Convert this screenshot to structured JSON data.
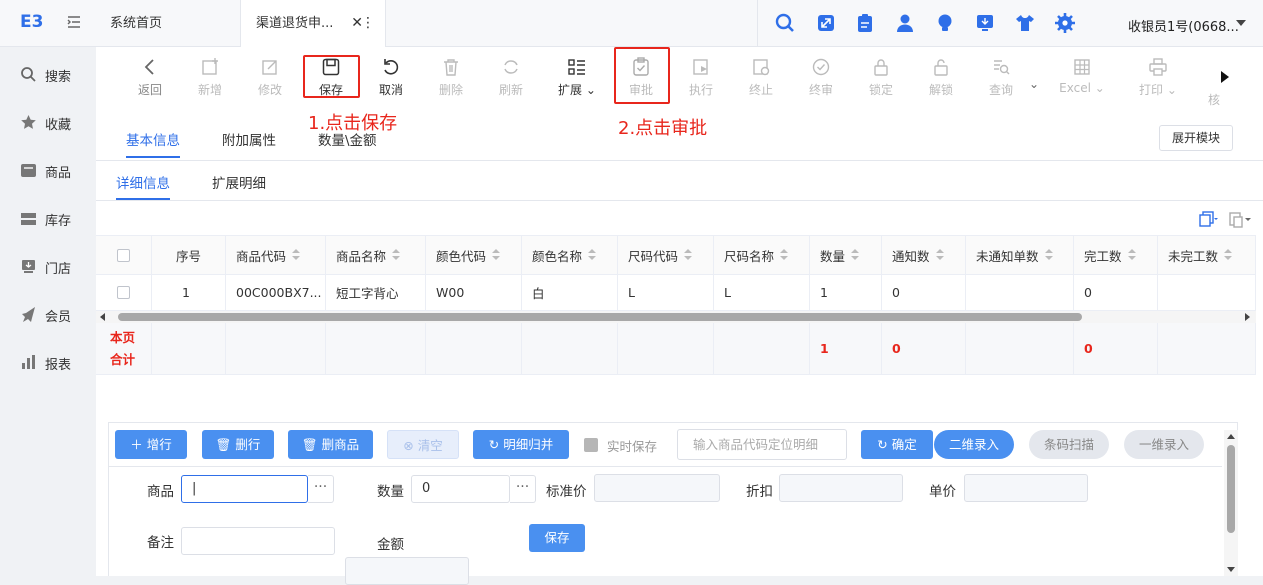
{
  "app": {
    "logo_text": "E3",
    "user": "收银员1号(0668...",
    "accent": "#2f6fe8",
    "annotation_color": "#e8261c"
  },
  "tabs": {
    "home": "系统首页",
    "active": "渠道退货申..."
  },
  "top_icons": [
    "search-icon",
    "expand-icon",
    "clipboard-icon",
    "user-icon",
    "bulb-icon",
    "monitor-icon",
    "shirt-icon",
    "gear-icon"
  ],
  "sidebar": {
    "items": [
      {
        "label": "搜索",
        "icon": "search-icon"
      },
      {
        "label": "收藏",
        "icon": "star-icon"
      },
      {
        "label": "商品",
        "icon": "product-icon"
      },
      {
        "label": "库存",
        "icon": "inventory-icon"
      },
      {
        "label": "门店",
        "icon": "store-icon"
      },
      {
        "label": "会员",
        "icon": "member-icon"
      },
      {
        "label": "报表",
        "icon": "report-icon"
      }
    ]
  },
  "toolbar": {
    "back": "返回",
    "add": "新增",
    "edit": "修改",
    "save": "保存",
    "cancel": "取消",
    "delete": "删除",
    "refresh": "刷新",
    "extend": "扩展",
    "approve": "审批",
    "execute": "执行",
    "stop": "终止",
    "final_review": "终审",
    "lock": "锁定",
    "unlock": "解锁",
    "query": "查询",
    "excel": "Excel",
    "print": "打印",
    "more": "核"
  },
  "annotations": {
    "step1": "1.点击保存",
    "step2": "2.点击审批"
  },
  "subtabs": {
    "basic": "基本信息",
    "attrs": "附加属性",
    "qty": "数量\\金额",
    "expand_module": "展开模块"
  },
  "detail_tabs": {
    "detail": "详细信息",
    "ext": "扩展明细"
  },
  "table": {
    "columns": [
      "序号",
      "商品代码",
      "商品名称",
      "颜色代码",
      "颜色名称",
      "尺码代码",
      "尺码名称",
      "数量",
      "通知数",
      "未通知单数",
      "完工数",
      "未完工数"
    ],
    "rows": [
      {
        "seq": "1",
        "code": "00C000BX7...",
        "name": "短工字背心",
        "color_code": "W00",
        "color_name": "白",
        "size_code": "L",
        "size_name": "L",
        "qty": "1",
        "notified": "0",
        "unnotified": "",
        "done": "0",
        "undone": ""
      }
    ],
    "totals": {
      "label_line1": "本页",
      "label_line2": "合计",
      "qty": "1",
      "notified": "0",
      "done": "0"
    }
  },
  "editor": {
    "add_row": "增行",
    "delete_row": "删行",
    "delete_product": "删商品",
    "clear": "清空",
    "merge_detail": "明细归并",
    "realtime_save": "实时保存",
    "locate_placeholder": "输入商品代码定位明细",
    "confirm": "确定",
    "qr_entry": "二维录入",
    "barcode_scan": "条码扫描",
    "oned_entry": "一维录入"
  },
  "form": {
    "product_label": "商品",
    "product_value": "",
    "quantity_label": "数量",
    "quantity_value": "0",
    "std_price_label": "标准价",
    "std_price_value": "",
    "discount_label": "折扣",
    "discount_value": "",
    "unit_price_label": "单价",
    "unit_price_value": "",
    "remark_label": "备注",
    "remark_value": "",
    "amount_label": "金额",
    "amount_value": "",
    "save": "保存"
  }
}
